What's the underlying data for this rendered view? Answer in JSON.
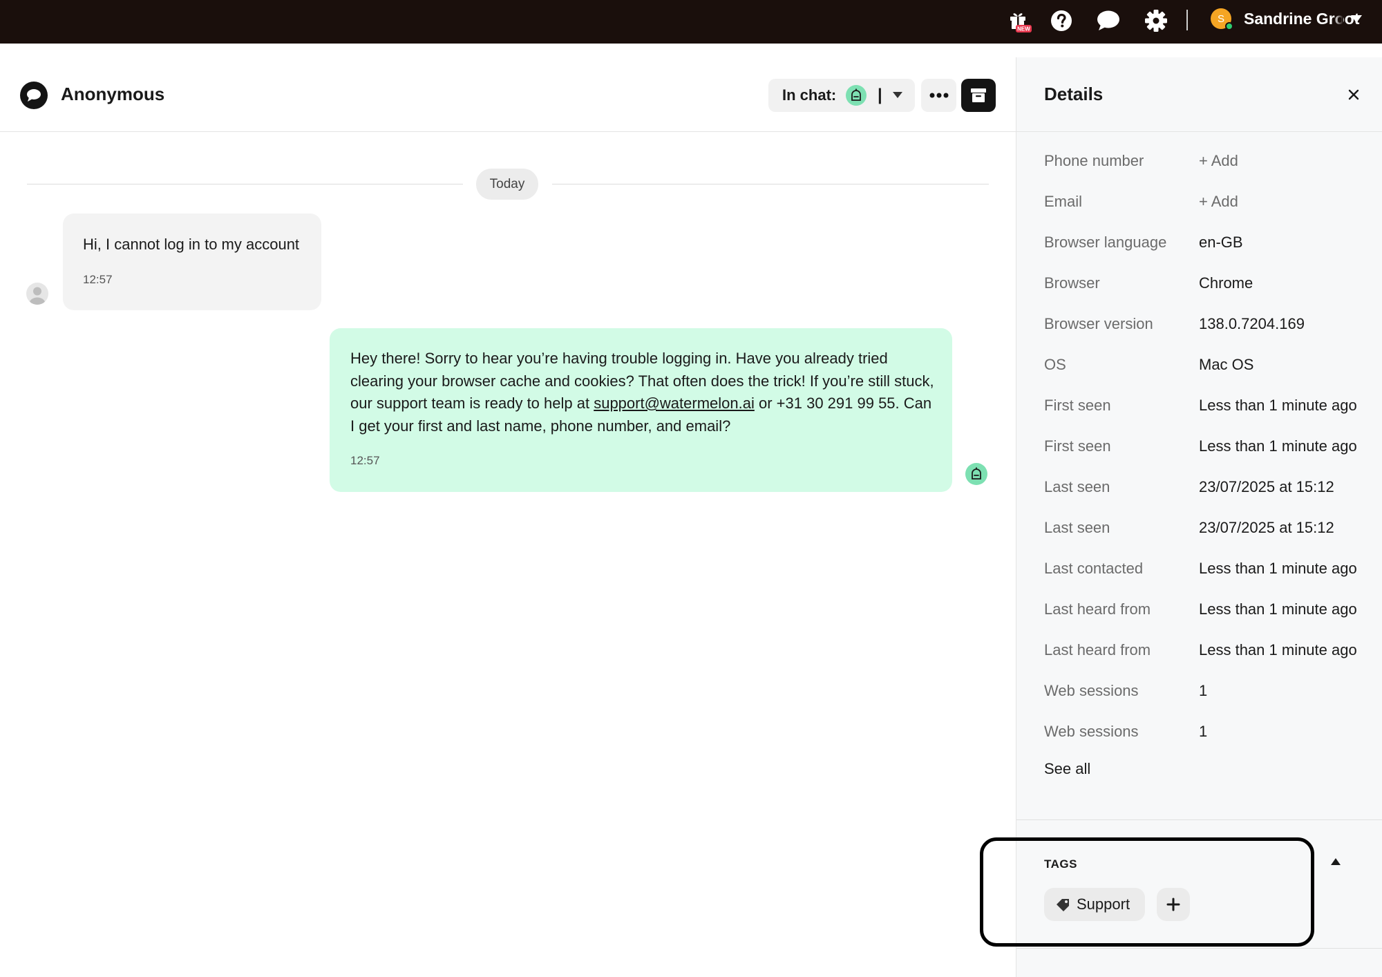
{
  "topbar": {
    "gift_badge": "NEW",
    "user_initial": "S",
    "user_name": "Sandrine Groot"
  },
  "chat": {
    "title": "Anonymous",
    "in_chat_label": "In chat:",
    "in_chat_separator": "|",
    "date_divider": "Today",
    "messages": [
      {
        "direction": "incoming",
        "text": "Hi, I cannot log in to my account",
        "time": "12:57"
      },
      {
        "direction": "outgoing",
        "text_before": "Hey there! Sorry to hear you’re having trouble logging in. Have you already tried clearing your browser cache and cookies? That often does the trick! If you’re still stuck, our support team is ready to help at ",
        "link": "support@watermelon.ai",
        "text_after": " or +31 30 291 99 55. Can I get your first and last name, phone number, and email?",
        "time": "12:57"
      }
    ]
  },
  "details": {
    "title": "Details",
    "rows": [
      {
        "label": "Phone number",
        "value": "+ Add"
      },
      {
        "label": "Email",
        "value": "+ Add"
      },
      {
        "label": "Browser language",
        "value": "en-GB"
      },
      {
        "label": "Browser",
        "value": "Chrome"
      },
      {
        "label": "Browser version",
        "value": "138.0.7204.169"
      },
      {
        "label": "OS",
        "value": "Mac OS"
      },
      {
        "label": "First seen",
        "value": "Less than 1 minute ago"
      },
      {
        "label": "First seen",
        "value": "Less than 1 minute ago"
      },
      {
        "label": "Last seen",
        "value": "23/07/2025 at 15:12"
      },
      {
        "label": "Last seen",
        "value": "23/07/2025 at 15:12"
      },
      {
        "label": "Last contacted",
        "value": "Less than 1 minute ago"
      },
      {
        "label": "Last heard from",
        "value": "Less than 1 minute ago"
      },
      {
        "label": "Last heard from",
        "value": "Less than 1 minute ago"
      },
      {
        "label": "Web sessions",
        "value": "1"
      },
      {
        "label": "Web sessions",
        "value": "1"
      }
    ],
    "see_all": "See all",
    "tags_title": "TAGS",
    "tags": [
      "Support"
    ]
  },
  "colors": {
    "topbar_bg": "#1a0f0c",
    "bot_accent": "#7de0b2",
    "outgoing_bubble": "#d2fbe6",
    "incoming_bubble": "#f3f3f3",
    "badge_red": "#e8384f",
    "avatar_orange": "#f5a524"
  },
  "icons": {
    "gift": "gift-icon",
    "help": "help-icon",
    "chat": "chat-icon",
    "settings": "gear-icon",
    "more": "more-horizontal-icon",
    "archive": "archive-icon",
    "close": "close-icon",
    "tag": "tag-icon",
    "add": "plus-icon",
    "bot": "bot-icon"
  }
}
